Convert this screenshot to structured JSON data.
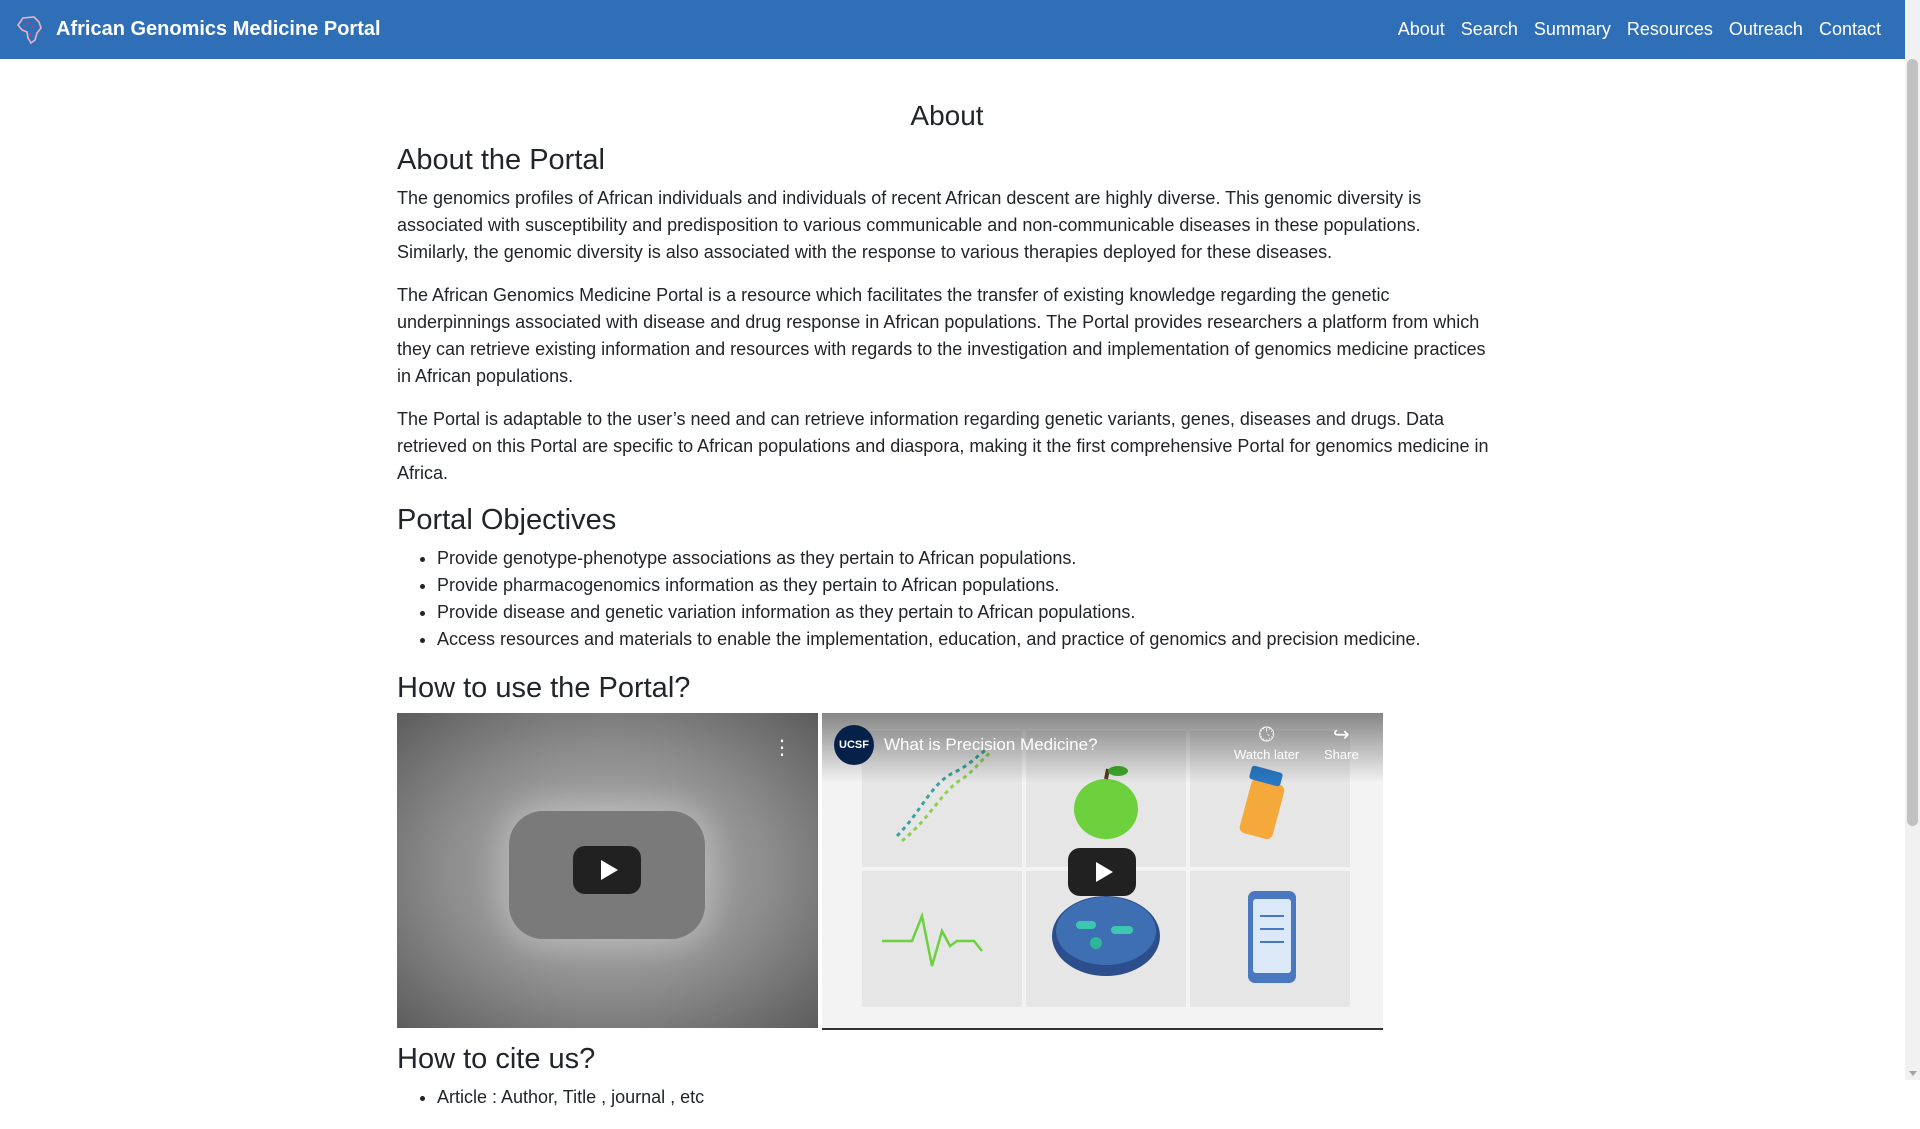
{
  "header": {
    "brand": "African Genomics Medicine Portal",
    "nav": [
      "About",
      "Search",
      "Summary",
      "Resources",
      "Outreach",
      "Contact"
    ]
  },
  "page_title": "About",
  "about": {
    "heading": "About the Portal",
    "paragraphs": [
      "The genomics profiles of African individuals and individuals of recent African descent are highly diverse. This genomic diversity is associated with susceptibility and predisposition to various communicable and non-communicable diseases in these populations. Similarly, the genomic diversity is also associated with the response to various therapies deployed for these diseases.",
      "The African Genomics Medicine Portal is a resource which facilitates the transfer of existing knowledge regarding the genetic underpinnings associated with disease and drug response in African populations. The Portal provides researchers a platform from which they can retrieve existing information and resources with regards to the investigation and implementation of genomics medicine practices in African populations.",
      "The Portal is adaptable to the user’s need and can retrieve information regarding genetic variants, genes, diseases and drugs. Data retrieved on this Portal are specific to African populations and diaspora, making it the first comprehensive Portal for genomics medicine in Africa."
    ]
  },
  "objectives": {
    "heading": "Portal Objectives",
    "items": [
      "Provide genotype-phenotype associations as they pertain to African populations.",
      "Provide pharmacogenomics information as they pertain to African populations.",
      "Provide disease and genetic variation information as they pertain to African populations.",
      "Access resources and materials to enable the implementation, education, and practice of genomics and precision medicine."
    ]
  },
  "howto": {
    "heading": "How to use the Portal?",
    "video2": {
      "channel": "UCSF",
      "title": "What is Precision Medicine?",
      "watch_later": "Watch later",
      "share": "Share"
    }
  },
  "cite": {
    "heading": "How to cite us?",
    "items": [
      "Article : Author, Title , journal , etc"
    ]
  },
  "colors": {
    "navbar": "#2f6fb8",
    "text": "#212529"
  }
}
